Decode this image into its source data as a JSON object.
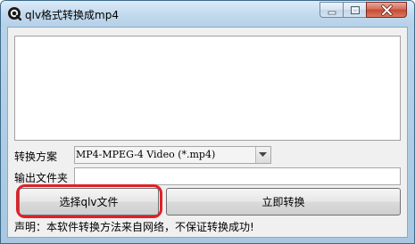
{
  "window": {
    "title": "qlv格式转换成mp4"
  },
  "form": {
    "format_label": "转换方案",
    "format_value": "MP4-MPEG-4 Video (*.mp4)",
    "output_label": "输出文件夹",
    "output_value": ""
  },
  "buttons": {
    "select_label": "选择qlv文件",
    "convert_label": "立即转换"
  },
  "statement": "声明：本软件转换方法来自网络，不保证转换成功!",
  "colors": {
    "highlight": "#e0202a",
    "close_button": "#c44a32"
  }
}
